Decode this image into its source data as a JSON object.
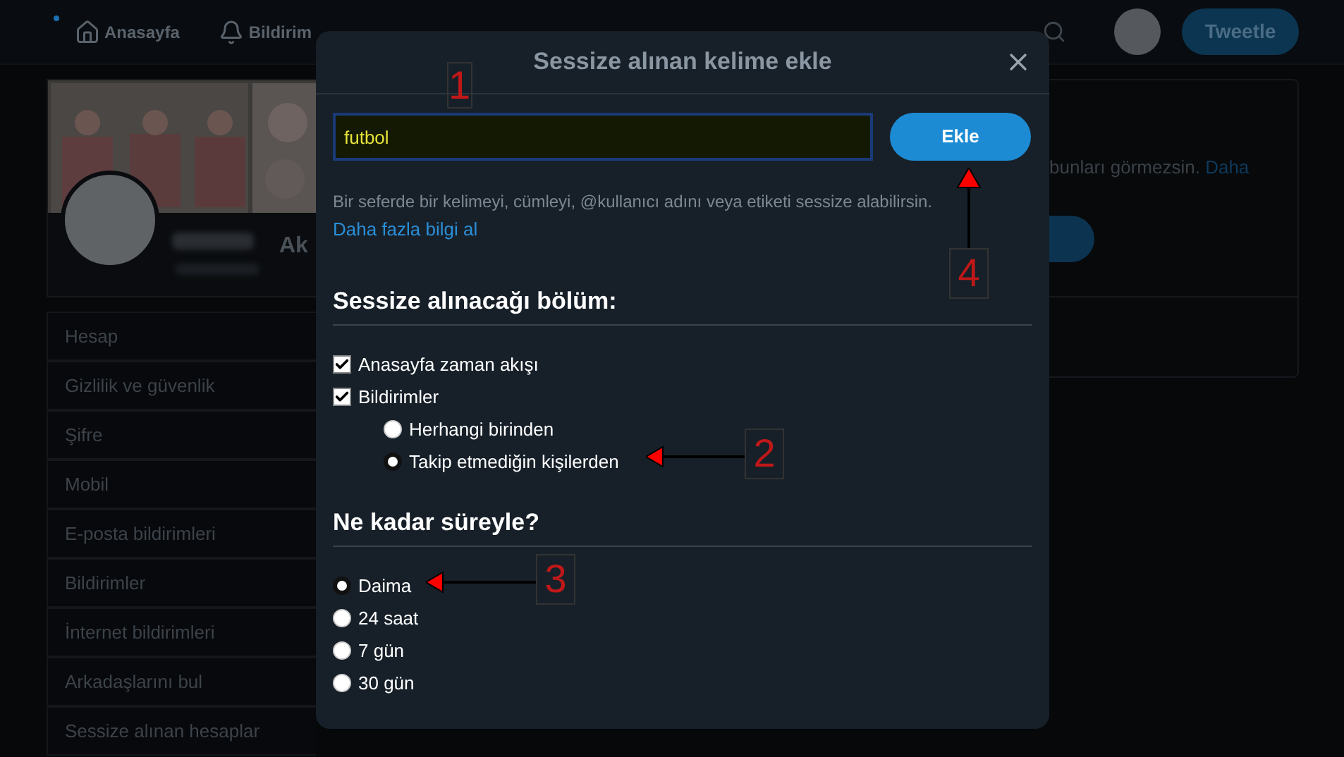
{
  "nav": {
    "items": [
      {
        "label": "Anasayfa"
      },
      {
        "label": "Bildirim"
      }
    ]
  },
  "tweet_button": "Tweetle",
  "profile": {
    "name": "Ak"
  },
  "settings_menu": {
    "items": [
      {
        "label": "Hesap"
      },
      {
        "label": "Gizlilik ve güvenlik"
      },
      {
        "label": "Şifre"
      },
      {
        "label": "Mobil"
      },
      {
        "label": "E-posta bildirimleri"
      },
      {
        "label": "Bildirimler"
      },
      {
        "label": "İnternet bildirimleri"
      },
      {
        "label": "Arkadaşlarını bul"
      },
      {
        "label": "Sessize alınan hesaplar"
      }
    ]
  },
  "right_panel": {
    "text": "bunları görmezsin.",
    "link": "Daha"
  },
  "dialog": {
    "title": "Sessize alınan kelime ekle",
    "input": {
      "value": "futbol"
    },
    "add_button": "Ekle",
    "help": "Bir seferde bir kelimeyi, cümleyi, @kullanıcı adını veya etiketi sessize alabilirsin.",
    "help_link": "Daha fazla bilgi al",
    "sections": [
      {
        "heading": "Sessize alınacağı bölüm:",
        "options": [
          {
            "kind": "checkbox",
            "label": "Anasayfa zaman akışı",
            "checked": true
          },
          {
            "kind": "checkbox",
            "label": "Bildirimler",
            "checked": true,
            "children": [
              {
                "kind": "radio",
                "label": "Herhangi birinden",
                "selected": false
              },
              {
                "kind": "radio",
                "label": "Takip etmediğin kişilerden",
                "selected": true
              }
            ]
          }
        ]
      },
      {
        "heading": "Ne kadar süreyle?",
        "options": [
          {
            "kind": "radio",
            "label": "Daima",
            "selected": true
          },
          {
            "kind": "radio",
            "label": "24 saat",
            "selected": false
          },
          {
            "kind": "radio",
            "label": "7 gün",
            "selected": false
          },
          {
            "kind": "radio",
            "label": "30 gün",
            "selected": false
          }
        ]
      }
    ]
  },
  "annotations": [
    {
      "label": "1",
      "kind": "box"
    },
    {
      "label": "2",
      "kind": "left"
    },
    {
      "label": "3",
      "kind": "left"
    },
    {
      "label": "4",
      "kind": "up"
    }
  ]
}
